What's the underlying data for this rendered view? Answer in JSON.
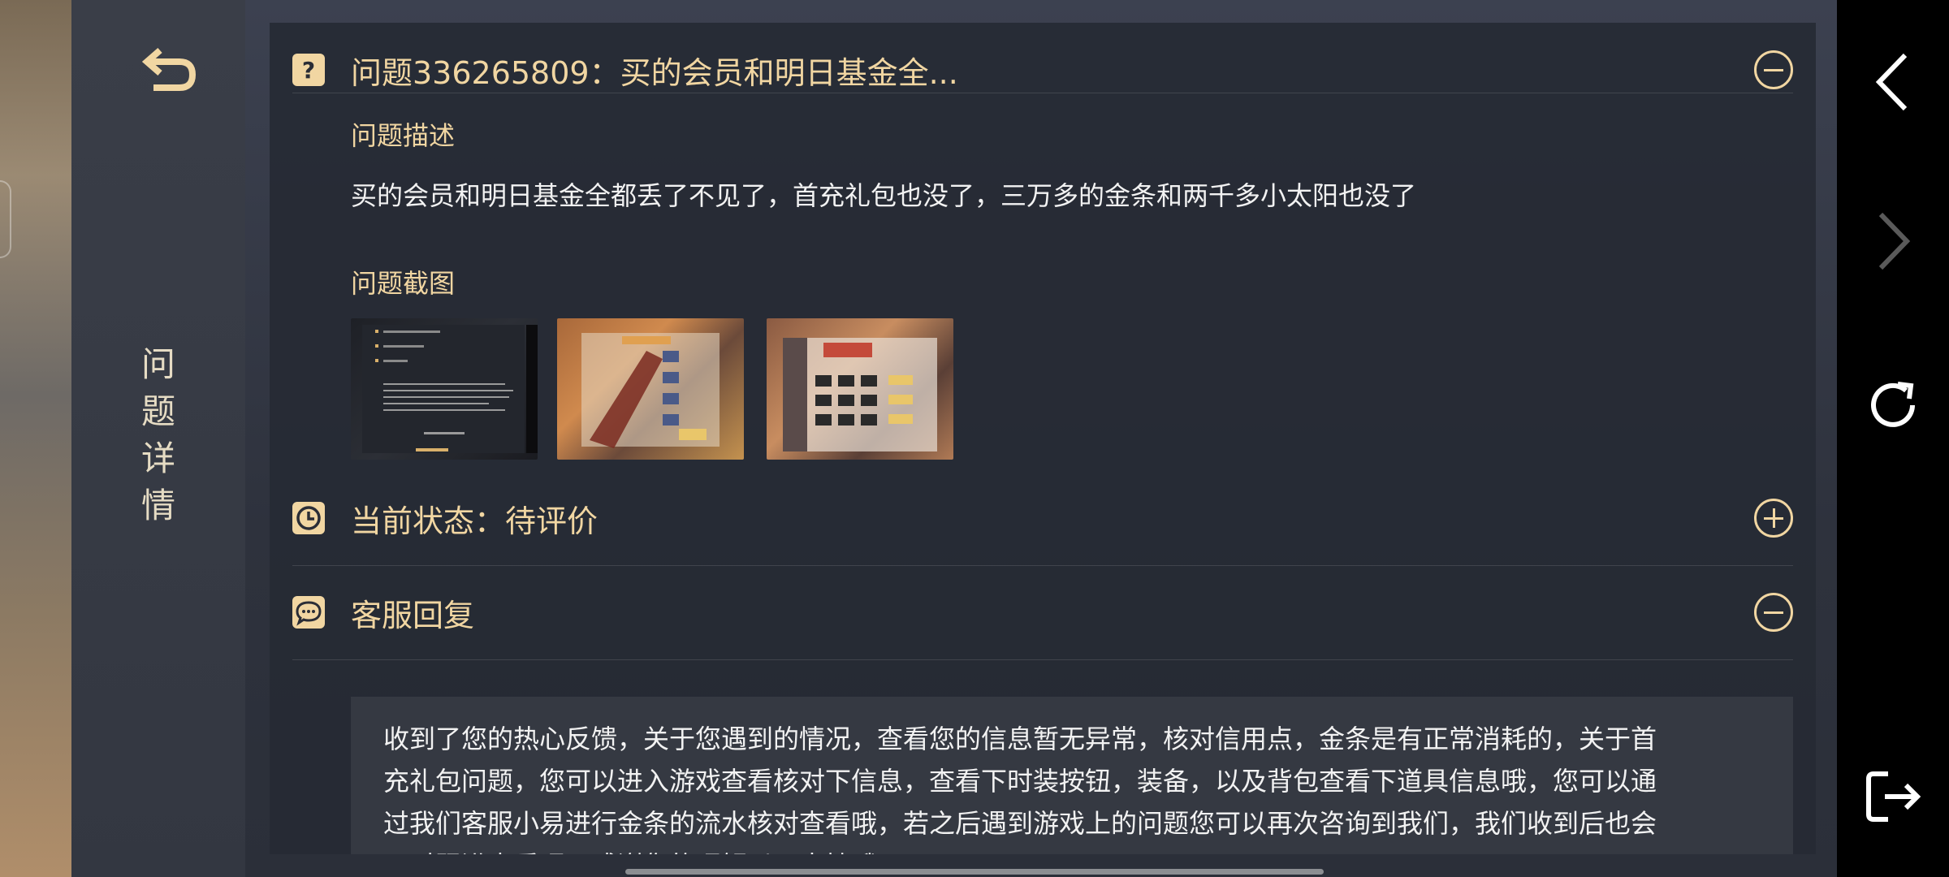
{
  "sidebar": {
    "title_chars": [
      "问",
      "题",
      "详",
      "情"
    ]
  },
  "question": {
    "title": "问题336265809：买的会员和明日基金全...",
    "description_label": "问题描述",
    "description": "买的会员和明日基金全都丢了不见了，首充礼包也没了，三万多的金条和两千多小太阳也没了",
    "screenshots_label": "问题截图",
    "toggle_state": "expanded"
  },
  "status": {
    "title": "当前状态：待评价",
    "toggle_state": "collapsed"
  },
  "reply": {
    "title": "客服回复",
    "toggle_state": "expanded",
    "lines": [
      "收到了您的热心反馈，关于您遇到的情况，查看您的信息暂无异常，核对信用点，金条是有正常消耗的，关于首",
      "充礼包问题，您可以进入游戏查看核对下信息，查看下时装按钮，装备，以及背包查看下道具信息哦，您可以通",
      "过我们客服小易进行金条的流水核对查看哦，若之后遇到游戏上的问题您可以再次咨询到我们，我们收到后也会",
      "及时跟进查看呢，感谢您的理解以及支持哦。~"
    ]
  },
  "colors": {
    "accent": "#f1d6a2",
    "text": "#f2f2f2",
    "panel": "#262a34"
  },
  "icons": {
    "back": "undo-arrow-icon",
    "question": "question-mark-icon",
    "status": "clock-icon",
    "reply": "chat-bubble-icon",
    "collapse": "minus-circle-icon",
    "expand": "plus-circle-icon",
    "nav_back": "chevron-left-icon",
    "nav_forward": "chevron-right-icon",
    "refresh": "refresh-icon",
    "exit": "exit-icon"
  }
}
